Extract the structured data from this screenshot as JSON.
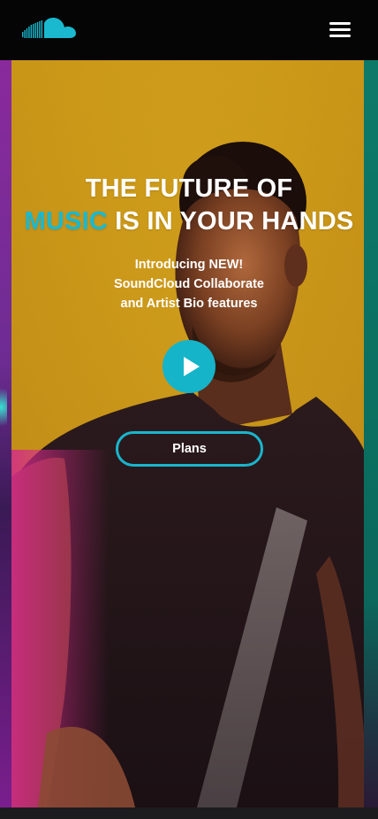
{
  "header": {
    "logo_icon": "soundcloud-cloud-logo",
    "menu_icon": "hamburger-menu-icon",
    "colors": {
      "background": "#050505",
      "logo": "#1ab9cf",
      "menu": "#ffffff"
    }
  },
  "hero": {
    "title_line1": "THE FUTURE OF",
    "title_accent": "MUSIC",
    "title_line2_rest": " IS IN YOUR HANDS",
    "subtitle_line1": "Introducing NEW!",
    "subtitle_line2": "SoundCloud Collaborate",
    "subtitle_line3": "and Artist Bio features",
    "play_icon": "play-icon",
    "plans_label": "Plans",
    "colors": {
      "accent": "#1ab9cf",
      "slide_background": "#d19e18",
      "left_slide": "#8a2a9c",
      "right_slide": "#0d7a69",
      "text": "#ffffff"
    }
  }
}
